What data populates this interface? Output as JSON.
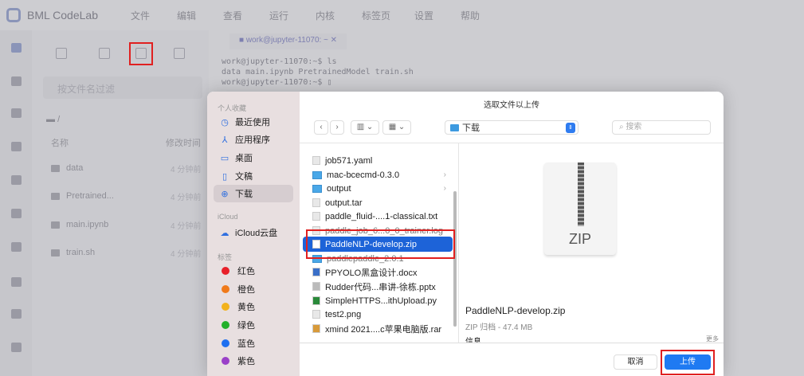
{
  "app": {
    "title": "BML CodeLab",
    "menu": [
      "文件",
      "编辑",
      "查看",
      "运行",
      "内核",
      "标签页",
      "设置",
      "帮助"
    ]
  },
  "filebrowser": {
    "filter_placeholder": "按文件名过滤",
    "breadcrumb": "/",
    "col_name": "名称",
    "col_modified": "修改时间",
    "files": [
      {
        "name": "data",
        "time": "4 分钟前",
        "type": "folder"
      },
      {
        "name": "Pretrained...",
        "time": "4 分钟前",
        "type": "folder"
      },
      {
        "name": "main.ipynb",
        "time": "4 分钟前",
        "type": "notebook"
      },
      {
        "name": "train.sh",
        "time": "4 分钟前",
        "type": "file"
      }
    ]
  },
  "terminal": {
    "tab": "work@jupyter-11070: ~",
    "lines": [
      "work@jupyter-11070:~$ ls",
      "data  main.ipynb  PretrainedModel  train.sh",
      "work@jupyter-11070:~$ ▯"
    ]
  },
  "dialog": {
    "title": "选取文件以上传",
    "location": "下载",
    "search_placeholder": "搜索",
    "sidebar": {
      "favorites_header": "个人收藏",
      "favorites": [
        {
          "label": "最近使用",
          "icon": "clock-icon"
        },
        {
          "label": "应用程序",
          "icon": "apps-icon"
        },
        {
          "label": "桌面",
          "icon": "desktop-icon"
        },
        {
          "label": "文稿",
          "icon": "document-icon"
        },
        {
          "label": "下载",
          "icon": "download-icon",
          "selected": true
        }
      ],
      "icloud_header": "iCloud",
      "icloud": [
        {
          "label": "iCloud云盘"
        }
      ],
      "tags_header": "标签",
      "tags": [
        {
          "label": "红色",
          "color": "#e8202a"
        },
        {
          "label": "橙色",
          "color": "#f07a1a"
        },
        {
          "label": "黄色",
          "color": "#f2b21c"
        },
        {
          "label": "绿色",
          "color": "#22b02a"
        },
        {
          "label": "蓝色",
          "color": "#1e6ff0"
        },
        {
          "label": "紫色",
          "color": "#9a40c8"
        }
      ]
    },
    "files": [
      {
        "name": "job571.yaml"
      },
      {
        "name": "mac-bcecmd-0.3.0",
        "dir": true
      },
      {
        "name": "output",
        "dir": true
      },
      {
        "name": "output.tar"
      },
      {
        "name": "paddle_fluid-....1-classical.txt"
      },
      {
        "name": "paddle_job_6...0_0_trainer.log"
      },
      {
        "name": "PaddleNLP-develop.zip",
        "selected": true
      },
      {
        "name": "paddlepaddle_2.0.1",
        "dir": true
      },
      {
        "name": "PPYOLO黑盒设计.docx"
      },
      {
        "name": "Rudder代码...串讲-徐栋.pptx"
      },
      {
        "name": "SimpleHTTPS...ithUpload.py"
      },
      {
        "name": "test2.png"
      },
      {
        "name": "xmind 2021....c苹果电脑版.rar"
      }
    ],
    "preview": {
      "icon_label": "ZIP",
      "name": "PaddleNLP-develop.zip",
      "kind": "ZIP 归档 - 47.4 MB",
      "info": "信息",
      "more": "更多"
    },
    "cancel": "取消",
    "upload": "上传"
  }
}
